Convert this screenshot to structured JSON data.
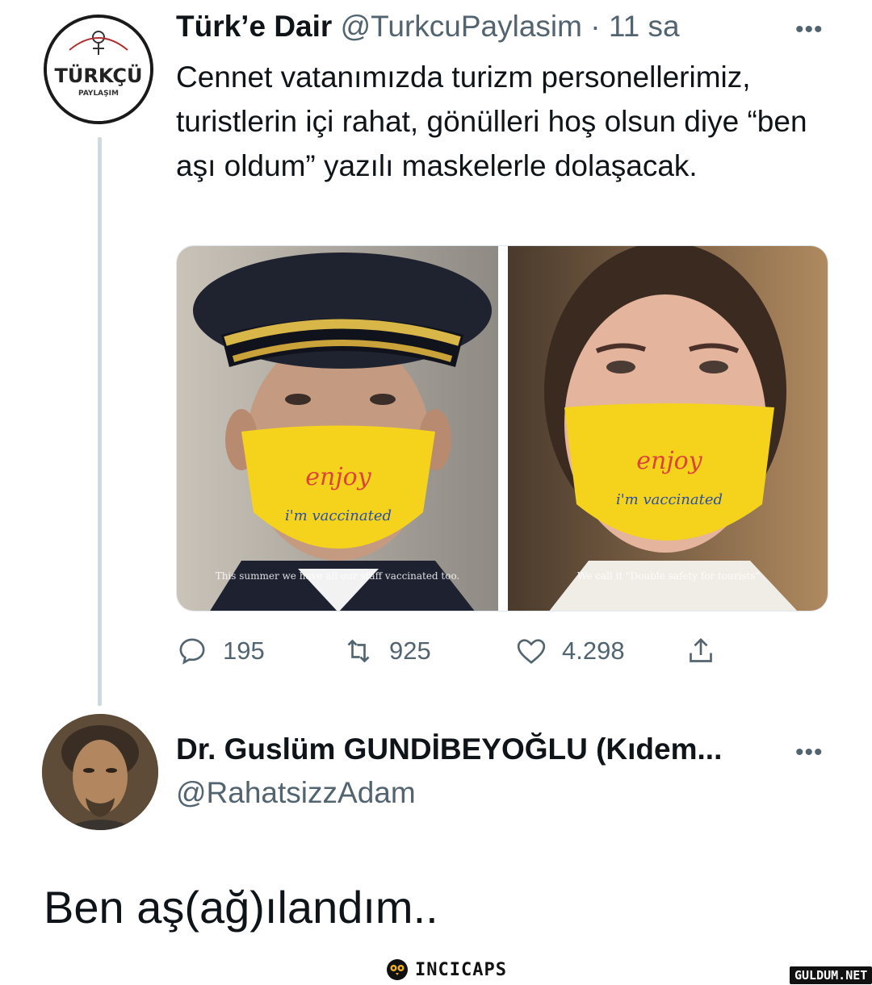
{
  "tweet1": {
    "display_name": "Türk’e Dair",
    "handle_time": "@TurkcuPaylasim · 11 sa",
    "text": "Cennet vatanımızda turizm personellerimiz, turistlerin içi rahat, gönülleri hoş olsun diye “ben aşı oldum” yazılı maskelerle dolaşacak.",
    "more_icon": "•••",
    "avatar_logo": {
      "line1": "TÜRKÇÜ",
      "line2": "PAYLAŞIM"
    },
    "media": {
      "left": {
        "mask_top": "enjoy",
        "mask_bottom": "i'm vaccinated",
        "caption": "This summer we have all our staff vaccinated too."
      },
      "right": {
        "mask_top": "enjoy",
        "mask_bottom": "i'm vaccinated",
        "caption": "We call it \"Double safety for tourists\""
      }
    },
    "actions": {
      "replies": "195",
      "retweets": "925",
      "likes": "4.298"
    }
  },
  "tweet2": {
    "display_name": "Dr. Guslüm GUNDİBEYOĞLU (Kıdem...",
    "handle": "@RahatsizzAdam",
    "more_icon": "•••",
    "text": "Ben aş(ağ)ılandım.."
  },
  "watermarks": {
    "incicaps": "INCICAPS",
    "guldum": "GULDUM.NET"
  },
  "colors": {
    "text": "#0f1419",
    "muted": "#536471",
    "mask": "#f5d31c",
    "thread_line": "#cfd9de"
  }
}
